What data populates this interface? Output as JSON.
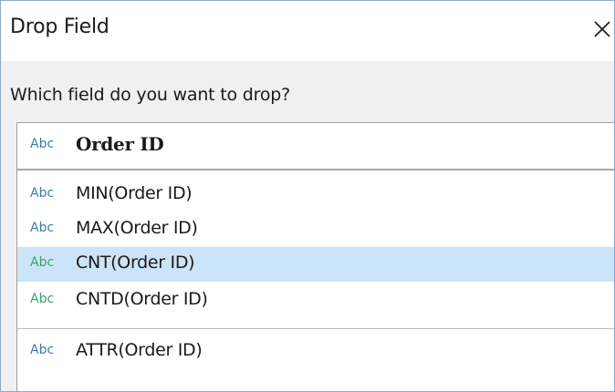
{
  "dialog": {
    "title": "Drop Field",
    "prompt": "Which field do you want to drop?",
    "close_icon": "close-icon"
  },
  "fields": [
    {
      "type_badge": "Abc",
      "label": "Order ID",
      "style": "bold",
      "selected": false
    },
    {
      "type_badge": "Abc",
      "label": "MIN(Order ID)",
      "selected": false
    },
    {
      "type_badge": "Abc",
      "label": "MAX(Order ID)",
      "selected": false
    },
    {
      "type_badge": "Abc",
      "label": "CNT(Order ID)",
      "selected": true
    },
    {
      "type_badge": "Abc",
      "label": "CNTD(Order ID)",
      "selected": false
    },
    {
      "type_badge": "Abc",
      "label": "ATTR(Order ID)",
      "selected": false
    }
  ],
  "colors": {
    "selected_bg": "#cce4f7",
    "abc_blue": "#3a7ea7",
    "abc_green": "#3aa36a",
    "window_border": "#8aa9d1"
  }
}
